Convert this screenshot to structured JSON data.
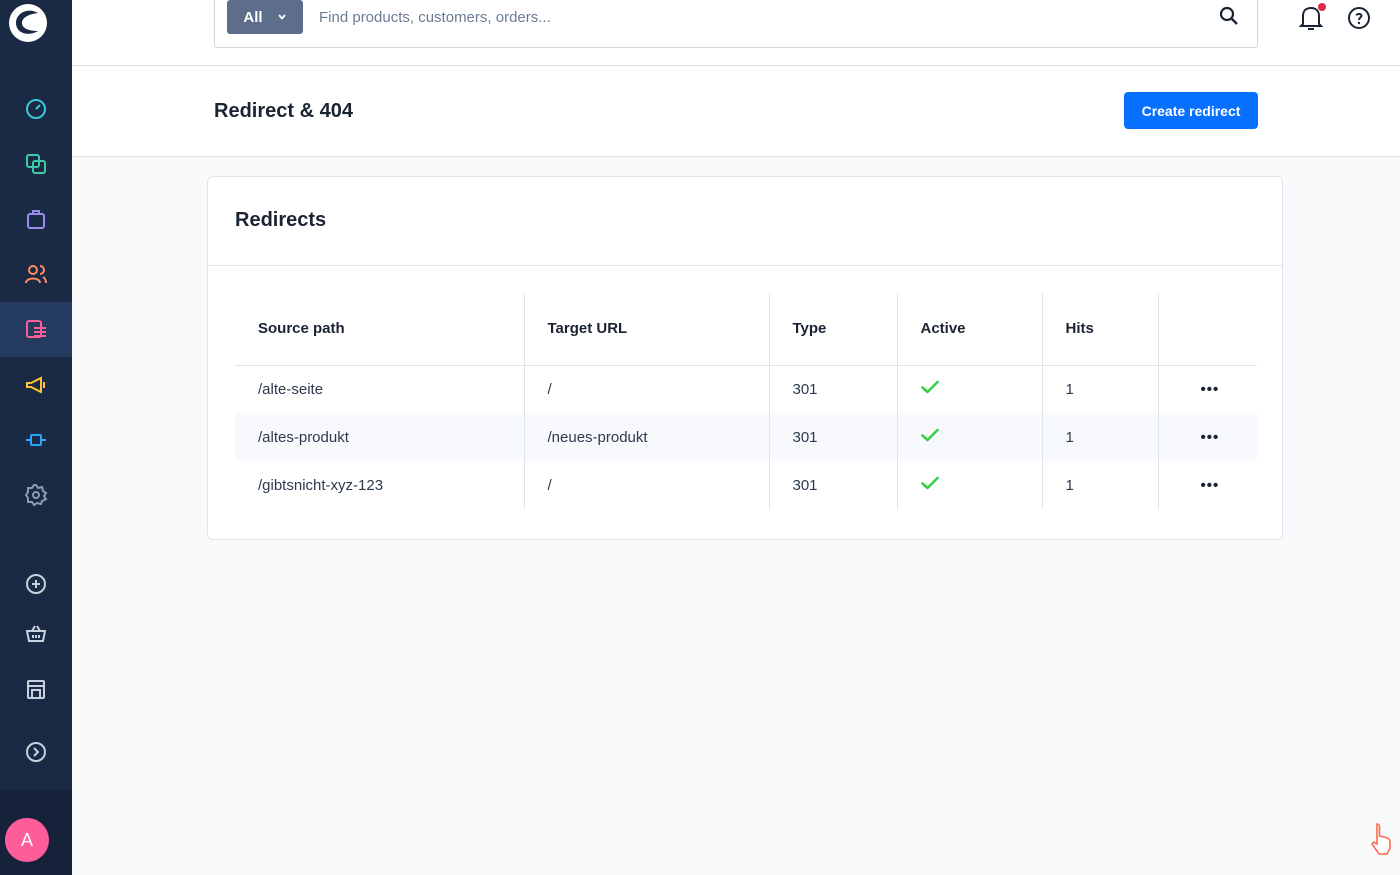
{
  "search": {
    "scope_label": "All",
    "placeholder": "Find products, customers, orders..."
  },
  "page": {
    "title": "Redirect & 404",
    "create_button": "Create redirect"
  },
  "sidebar": {
    "avatar_initial": "A",
    "items": [
      {
        "icon": "dashboard-icon",
        "color": "#3bc9d8"
      },
      {
        "icon": "catalogue-icon",
        "color": "#3bc9a6"
      },
      {
        "icon": "orders-icon",
        "color": "#9b8cf0"
      },
      {
        "icon": "customers-icon",
        "color": "#ff8a65"
      },
      {
        "icon": "content-icon",
        "color": "#ff5c9a",
        "active": true
      },
      {
        "icon": "marketing-icon",
        "color": "#ffc233"
      },
      {
        "icon": "extensions-icon",
        "color": "#2aa4ff"
      },
      {
        "icon": "settings-icon",
        "color": "#8a9bb4"
      },
      {
        "icon": "add-icon",
        "color": "#c8d1de"
      },
      {
        "icon": "basket-icon",
        "color": "#c8d1de"
      },
      {
        "icon": "storefront-icon",
        "color": "#c8d1de"
      },
      {
        "icon": "expand-icon",
        "color": "#c8d1de"
      }
    ]
  },
  "redirects": {
    "title": "Redirects",
    "columns": [
      "Source path",
      "Target URL",
      "Type",
      "Active",
      "Hits"
    ],
    "rows": [
      {
        "source": "/alte-seite",
        "target": "/",
        "type": "301",
        "active": true,
        "hits": "1"
      },
      {
        "source": "/altes-produkt",
        "target": "/neues-produkt",
        "type": "301",
        "active": true,
        "hits": "1"
      },
      {
        "source": "/gibtsnicht-xyz-123",
        "target": "/",
        "type": "301",
        "active": true,
        "hits": "1"
      }
    ],
    "actions_label": "•••"
  },
  "colors": {
    "primary": "#0870ff",
    "sidebar_bg": "#1b2a44",
    "check": "#37d046",
    "notification_dot": "#de294c"
  }
}
